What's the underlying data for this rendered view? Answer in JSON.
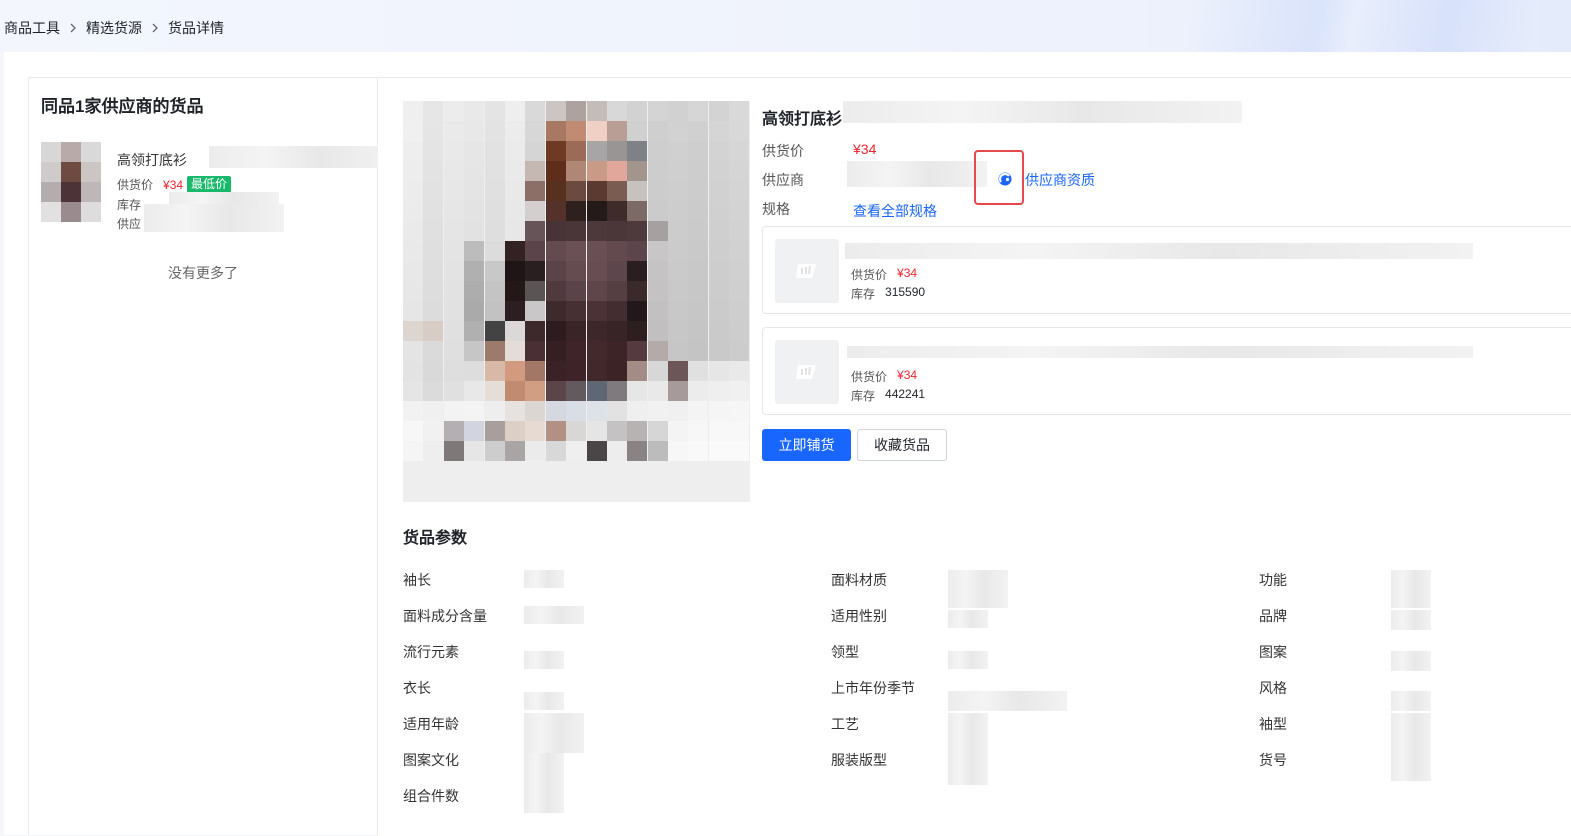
{
  "breadcrumb": [
    "商品工具",
    "精选货源",
    "货品详情"
  ],
  "left_panel": {
    "title": "同品1家供应商的货品",
    "item": {
      "name": "高领打底衫",
      "price_label": "供货价",
      "price": "¥34",
      "badge": "最低价",
      "stock_label": "库存",
      "supplier_label": "供应"
    },
    "no_more": "没有更多了"
  },
  "product": {
    "title": "高领打底衫",
    "price_label": "供货价",
    "price": "¥34",
    "supplier_label": "供应商",
    "supplier_qualification_link": "供应商资质",
    "spec_label": "规格",
    "view_all_specs_link": "查看全部规格",
    "specs": [
      {
        "price_label": "供货价",
        "price": "¥34",
        "stock_label": "库存",
        "stock": "315590"
      },
      {
        "price_label": "供货价",
        "price": "¥34",
        "stock_label": "库存",
        "stock": "442241"
      }
    ],
    "actions": {
      "distribute": "立即铺货",
      "favorite": "收藏货品"
    }
  },
  "params": {
    "title": "货品参数",
    "columns": [
      [
        "袖长",
        "面料成分含量",
        "流行元素",
        "衣长",
        "适用年龄",
        "图案文化",
        "组合件数"
      ],
      [
        "面料材质",
        "适用性别",
        "领型",
        "上市年份季节",
        "工艺",
        "服装版型"
      ],
      [
        "功能",
        "品牌",
        "图案",
        "风格",
        "袖型",
        "货号"
      ]
    ]
  },
  "icons": {
    "breadcrumb_separator": "chevron-right-icon",
    "supplier_chat": "chat-icon",
    "spec_placeholder": "image-placeholder-icon"
  },
  "colors": {
    "primary": "#1966ff",
    "price": "#f5222d",
    "badge_green": "#19b96b",
    "highlight_box": "#e5484d"
  }
}
